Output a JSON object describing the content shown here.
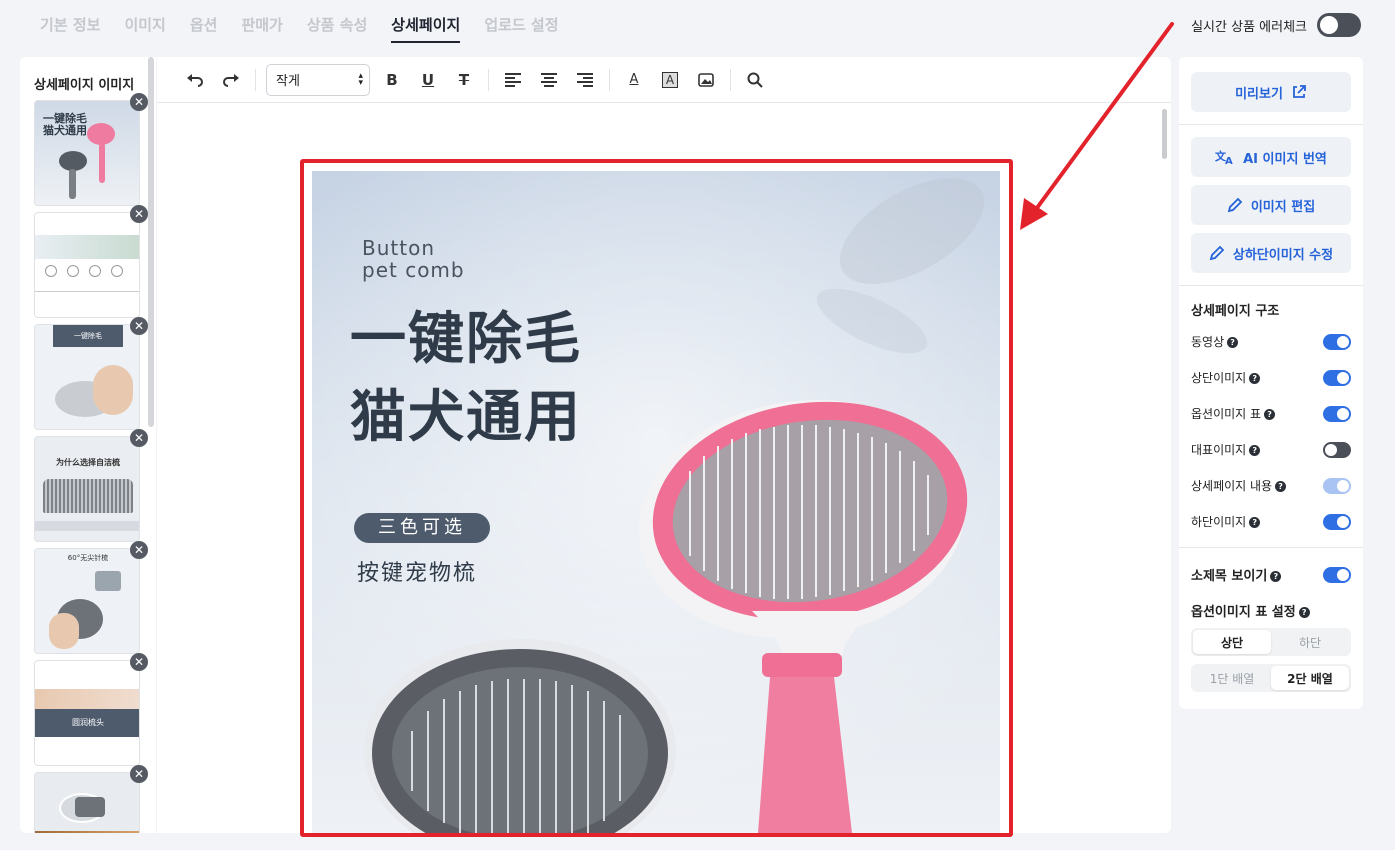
{
  "tabs": [
    {
      "label": "기본 정보"
    },
    {
      "label": "이미지"
    },
    {
      "label": "옵션"
    },
    {
      "label": "판매가"
    },
    {
      "label": "상품 속성"
    },
    {
      "label": "상세페이지",
      "active": true
    },
    {
      "label": "업로드 설정"
    }
  ],
  "error_check": {
    "label": "실시간 상품 에러체크",
    "enabled": false
  },
  "thumb_panel": {
    "title": "상세페이지 이미지",
    "items": [
      {
        "caption": "一键除毛\n猫犬通用"
      },
      {
        "caption": ""
      },
      {
        "caption": "一键除毛"
      },
      {
        "caption": "为什么选择自洁梳"
      },
      {
        "caption": "60°无尖针梳"
      },
      {
        "caption": "圆润梳头"
      },
      {
        "caption": ""
      }
    ]
  },
  "toolbar": {
    "undo_icon": "undo-icon",
    "redo_icon": "redo-icon",
    "font_size": "작게",
    "bold": "B",
    "underline": "U",
    "strike": "T",
    "text_color": "A",
    "bg_color": "A"
  },
  "canvas": {
    "en_line1": "Button",
    "en_line2": "pet comb",
    "cn_line1": "一键除毛",
    "cn_line2": "猫犬通用",
    "pill": "三色可选",
    "sub": "按键宠物梳"
  },
  "right_panel": {
    "preview": "미리보기",
    "ai_translate": "AI 이미지 번역",
    "edit_image": "이미지 편집",
    "edit_topbottom": "상하단이미지 수정",
    "structure_title": "상세페이지 구조",
    "structure": [
      {
        "label": "동영상",
        "state": "on"
      },
      {
        "label": "상단이미지",
        "state": "on"
      },
      {
        "label": "옵션이미지 표",
        "state": "on"
      },
      {
        "label": "대표이미지",
        "state": "off"
      },
      {
        "label": "상세페이지 내용",
        "state": "light"
      },
      {
        "label": "하단이미지",
        "state": "on"
      }
    ],
    "subtitle_label": "소제목 보이기",
    "option_table_title": "옵션이미지 표 설정",
    "position_options": [
      "상단",
      "하단"
    ],
    "position_selected": "상단",
    "layout_options": [
      "1단 배열",
      "2단 배열"
    ],
    "layout_selected": "2단 배열"
  },
  "colors": {
    "accent": "#2f6fe4",
    "highlight_frame": "#e3232c",
    "arrow": "#e3232c"
  }
}
